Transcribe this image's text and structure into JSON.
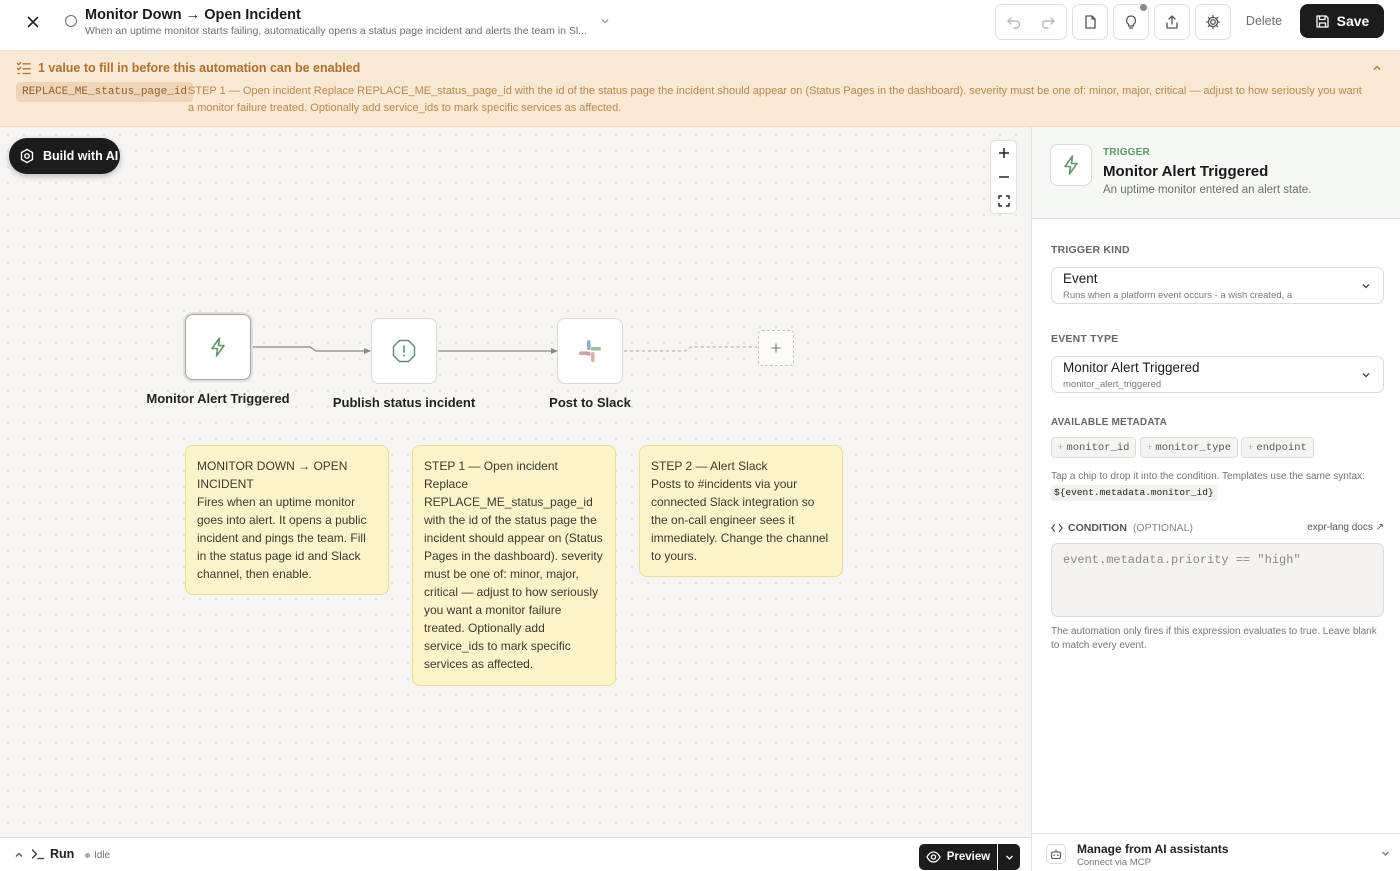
{
  "header": {
    "title": "Monitor Down → Open Incident",
    "subtitle": "When an uptime monitor starts failing, automatically opens a status page incident and alerts the team in Sl...",
    "delete_label": "Delete",
    "save_label": "Save"
  },
  "banner": {
    "title": "1 value to fill in before this automation can be enabled",
    "placeholder_key": "REPLACE_ME_status_page_id",
    "message": "STEP 1 — Open incident Replace REPLACE_ME_status_page_id with the id of the status page the incident should appear on (Status Pages in the dashboard). severity must be one of: minor, major, critical — adjust to how seriously you want a monitor failure treated. Optionally add service_ids to mark specific services as affected."
  },
  "canvas": {
    "build_ai_label": "Build with AI",
    "nodes": [
      {
        "label": "Monitor Alert Triggered",
        "icon": "lightning-icon"
      },
      {
        "label": "Publish status incident",
        "icon": "alert-octagon-icon"
      },
      {
        "label": "Post to Slack",
        "icon": "slack-icon"
      }
    ],
    "notes": [
      {
        "title": "MONITOR DOWN → OPEN INCIDENT",
        "body": "Fires when an uptime monitor goes into alert. It opens a public incident and pings the team. Fill in the status page id and Slack channel, then enable."
      },
      {
        "title": "STEP 1 — Open incident",
        "body": "Replace REPLACE_ME_status_page_id with the id of the status page the incident should appear on (Status Pages in the dashboard). severity must be one of: minor, major, critical — adjust to how seriously you want a monitor failure treated. Optionally add service_ids to mark specific services as affected."
      },
      {
        "title": "STEP 2 — Alert Slack",
        "body": "Posts to #incidents via your connected Slack integration so the on-call engineer sees it immediately. Change the channel to yours."
      }
    ]
  },
  "bottombar": {
    "run_label": "Run",
    "status": "Idle",
    "preview_label": "Preview"
  },
  "panel": {
    "kicker": "TRIGGER",
    "title": "Monitor Alert Triggered",
    "description": "An uptime monitor entered an alert state.",
    "trigger_kind_label": "TRIGGER KIND",
    "trigger_kind_value": "Event",
    "trigger_kind_sub": "Runs when a platform event occurs - a wish created, a",
    "event_type_label": "EVENT TYPE",
    "event_type_value": "Monitor Alert Triggered",
    "event_type_sub": "monitor_alert_triggered",
    "metadata_label": "AVAILABLE METADATA",
    "metadata_chips": [
      "monitor_id",
      "monitor_type",
      "endpoint"
    ],
    "metadata_hint": "Tap a chip to drop it into the condition. Templates use the same syntax:",
    "metadata_template": "${event.metadata.monitor_id}",
    "condition_label": "CONDITION",
    "condition_optional": "(OPTIONAL)",
    "docs_label": "expr-lang docs ↗",
    "condition_placeholder": "event.metadata.priority == \"high\"",
    "condition_help": "The automation only fires if this expression evaluates to true. Leave blank to match every event.",
    "footer_title": "Manage from AI assistants",
    "footer_sub": "Connect via MCP"
  },
  "colors": {
    "accent_green": "#5d9a6a",
    "banner_bg": "#f8e8d4",
    "banner_text": "#b3702a",
    "note_bg": "#fdf3c9",
    "primary_dark": "#1c1c1c"
  }
}
